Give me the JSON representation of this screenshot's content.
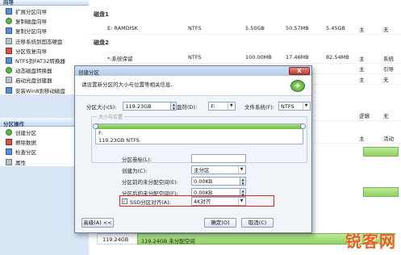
{
  "sidebar": {
    "wizard_header": "向导",
    "wizard_items": [
      {
        "label": "扩展分区向导",
        "icon": "expand-icon"
      },
      {
        "label": "复制磁盘向导",
        "icon": "copy-disk-icon"
      },
      {
        "label": "复制分区向导",
        "icon": "copy-partition-icon"
      },
      {
        "label": "迁移系统到固态硬盘",
        "icon": "migrate-icon"
      },
      {
        "label": "分区恢复向导",
        "icon": "recovery-icon"
      },
      {
        "label": "NTFS到FAT32转换器",
        "icon": "convert-icon"
      },
      {
        "label": "动态磁盘转换器",
        "icon": "dynamic-disk-icon"
      },
      {
        "label": "启动光盘创建器",
        "icon": "boot-cd-icon"
      },
      {
        "label": "安装Win8到移动磁盘",
        "icon": "win8-icon"
      }
    ],
    "ops_header": "分区操作",
    "ops_items": [
      {
        "label": "创建分区",
        "icon": "create-partition-icon"
      },
      {
        "label": "擦除数据",
        "icon": "wipe-icon"
      },
      {
        "label": "检查分区",
        "icon": "check-icon"
      },
      {
        "label": "属性",
        "icon": "properties-icon"
      }
    ]
  },
  "main": {
    "disk1": "磁盘1",
    "disk2": "磁盘2",
    "rows": [
      {
        "name": "E: RAMDISK",
        "fs": "NTFS",
        "cap": "5.50GB",
        "used": "50.57MB",
        "free": "5.45GB",
        "type": "主",
        "status": "无"
      },
      {
        "name": "*:系统保留",
        "fs": "NTFS",
        "cap": "100.00MB",
        "used": "17.46MB",
        "free": "82.54MB",
        "type": "主",
        "status": "系统"
      },
      {
        "name": "",
        "fs": "",
        "cap": "",
        "used": "",
        "free": "",
        "type": "主",
        "status": "引导"
      },
      {
        "name": "",
        "fs": "",
        "cap": "",
        "used": "",
        "free": "",
        "type": "主",
        "status": "无"
      },
      {
        "name": "",
        "fs": "",
        "cap": "",
        "used": "",
        "free": "",
        "type": "逻辑",
        "status": "无"
      },
      {
        "name": "",
        "fs": "",
        "cap": "",
        "used": "",
        "free": "",
        "type": "主",
        "status": "活动"
      }
    ],
    "bottom_bar_size": "119.24GB",
    "bottom_bar_label": "119.24GB 未分配空间"
  },
  "dialog": {
    "title": "创建分区",
    "close": "X",
    "instruction": "请设置新分区的大小与位置等相关信息.",
    "size_label": "分区大小(S):",
    "size_value": "119.23GB",
    "drive_label": "盘符(D):",
    "drive_value": "F:",
    "fs_label": "文件系统(F):",
    "fs_value": "NTFS",
    "group_legend": "大小与位置",
    "bar_drive": "F:",
    "bar_info": "119.23GB NTFS",
    "vol_label": "分区卷标(L):",
    "vol_value": "",
    "create_as_label": "创建为(C):",
    "create_as_value": "主分区",
    "before_label": "分区前的未分配空间(E):",
    "before_value": "0.00KB",
    "after_label": "分区后的未分配空间(F):",
    "after_value": "0.00KB",
    "ssd_label": "SSD分区对齐(A):",
    "ssd_value": "4K对齐",
    "ssd_checked": true,
    "advanced": "高级(A) <<",
    "ok": "确定(O)",
    "cancel": "取消(C)"
  },
  "watermark": "锐客网",
  "colors": {
    "accent": "#6dbf44",
    "highlight_border": "#d8241b"
  }
}
